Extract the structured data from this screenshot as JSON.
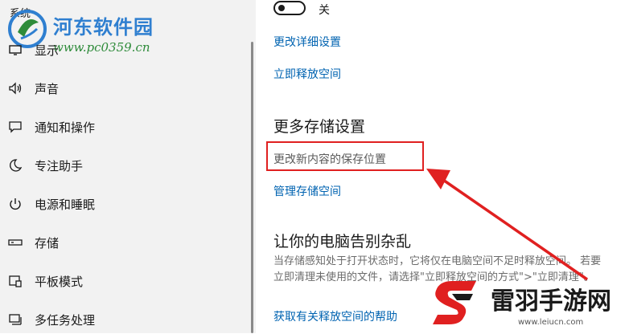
{
  "sidebar": {
    "section_label": "系统",
    "items": [
      {
        "label": "显示",
        "icon": "display-icon"
      },
      {
        "label": "声音",
        "icon": "speaker-icon"
      },
      {
        "label": "通知和操作",
        "icon": "notification-icon"
      },
      {
        "label": "专注助手",
        "icon": "moon-icon"
      },
      {
        "label": "电源和睡眠",
        "icon": "power-icon"
      },
      {
        "label": "存储",
        "icon": "storage-icon"
      },
      {
        "label": "平板模式",
        "icon": "tablet-icon"
      },
      {
        "label": "多任务处理",
        "icon": "multitask-icon"
      }
    ]
  },
  "watermark": {
    "name": "河东软件园",
    "url": "www.pc0359.cn"
  },
  "main": {
    "toggle_state": "关",
    "link_change_details": "更改详细设置",
    "link_free_space": "立即释放空间",
    "heading_more": "更多存储设置",
    "link_change_location": "更改新内容的保存位置",
    "link_manage_spaces": "管理存储空间",
    "heading_clutter": "让你的电脑告别杂乱",
    "description": "当存储感知处于打开状态时，它将仅在电脑空间不足时释放空间。 若要立即清理未使用的文件，请选择\"立即释放空间的方式\">\"立即清理\"。",
    "link_help": "获取有关释放空间的帮助"
  },
  "brand": {
    "name": "雷羽手游网",
    "url": "www.leiucn.com"
  },
  "colors": {
    "accent": "#0063b1",
    "highlight": "#e02020",
    "sidebar_bg": "#f2f2f2"
  }
}
